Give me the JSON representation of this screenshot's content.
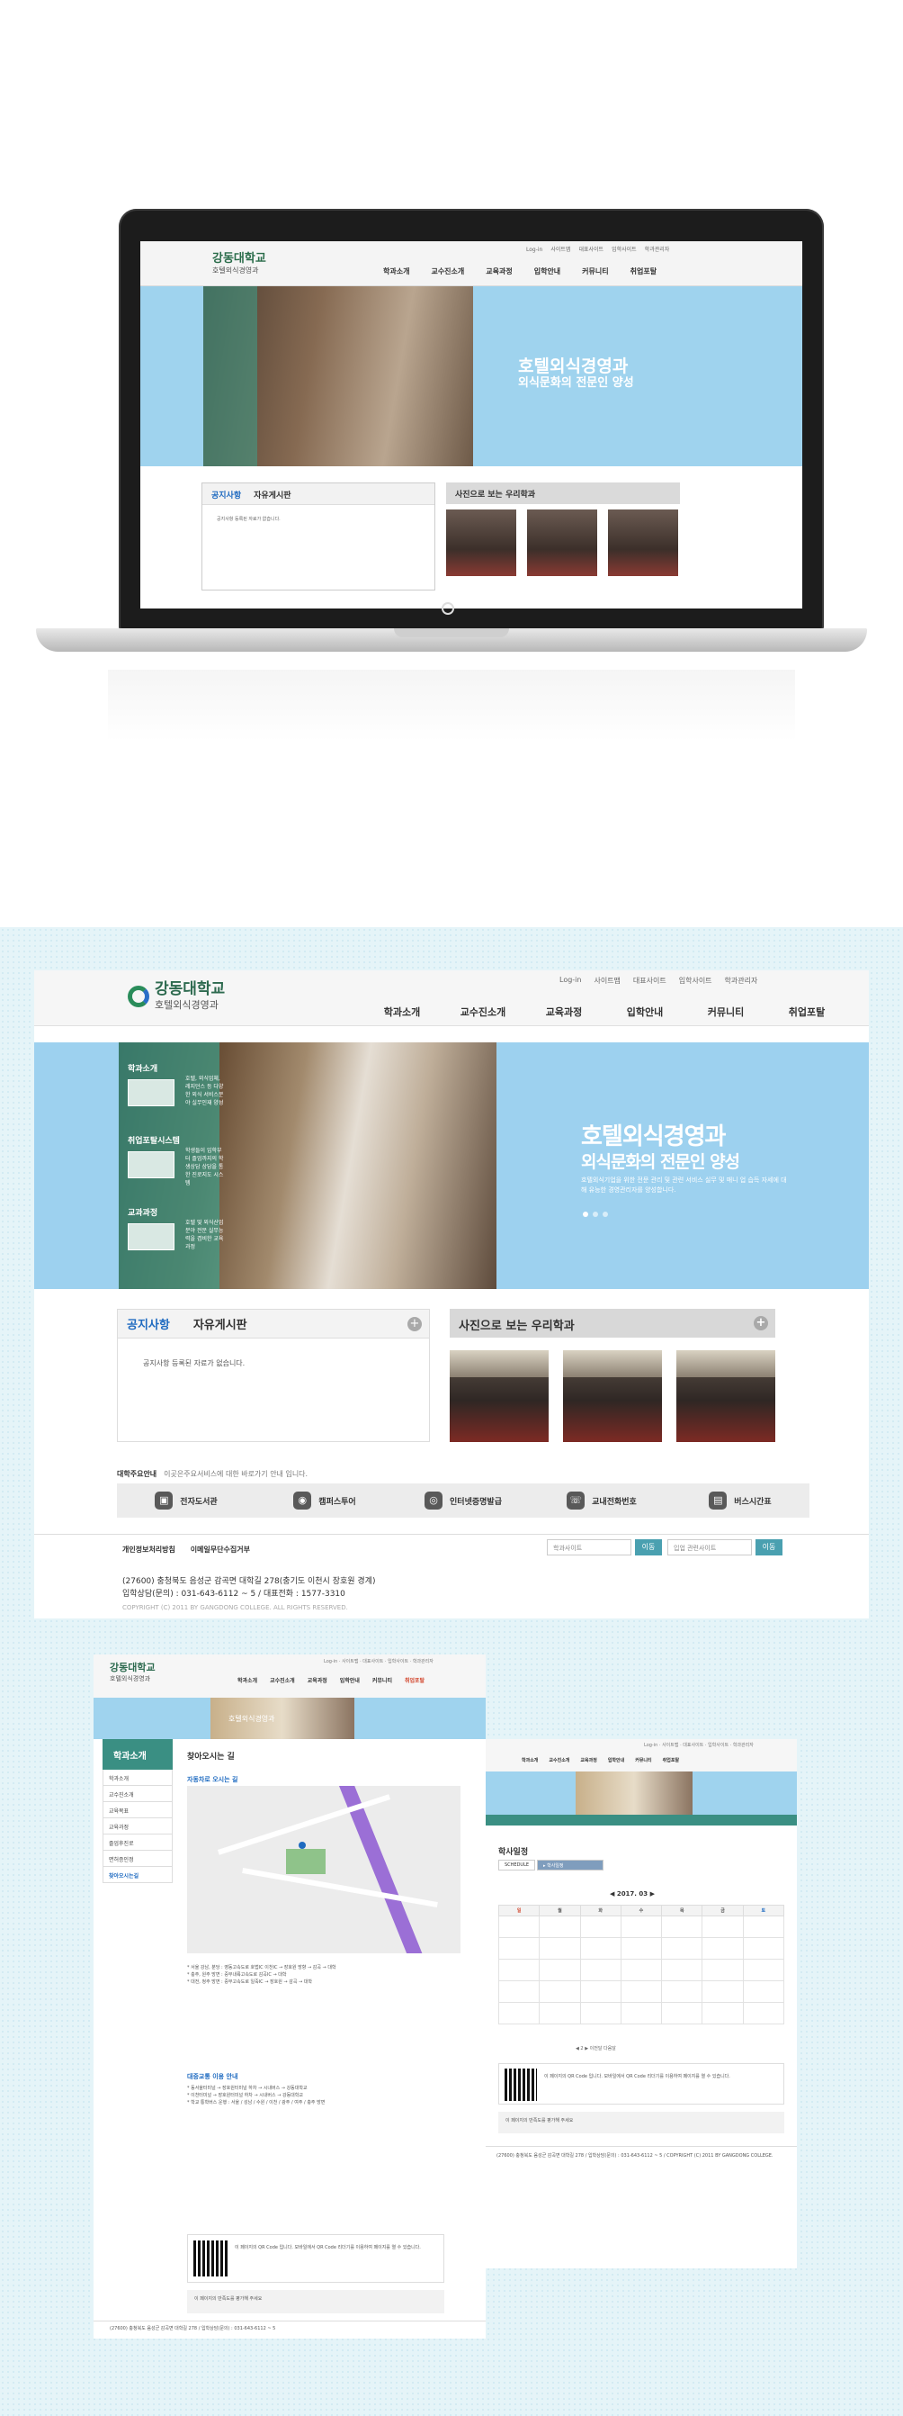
{
  "brand": {
    "name": "강동대학교",
    "dept": "호텔외식경영과"
  },
  "laptop": {
    "util": [
      "Log-in",
      "사이트맵",
      "대표사이트",
      "입학사이트",
      "학과관리자"
    ],
    "nav": [
      "학과소개",
      "교수진소개",
      "교육과정",
      "입학안내",
      "커뮤니티",
      "취업포탈"
    ],
    "hero_title": "호텔외식경영과",
    "hero_sub": "외식문화의 전문인 양성",
    "notice_tab": "공지사항",
    "board_tab": "자유게시판",
    "photo_title": "사진으로 보는 우리학과",
    "notice_empty": "공지사항 등록된 자료가 없습니다."
  },
  "main": {
    "util": [
      "Log-in",
      "사이트맵",
      "대표사이트",
      "입학사이트",
      "학과관리자"
    ],
    "nav": [
      "학과소개",
      "교수진소개",
      "교육과정",
      "입학안내",
      "커뮤니티",
      "취업포탈"
    ],
    "quick": [
      {
        "title": "학과소개",
        "desc": "호텔, 외식업체, 레지던스 등 다양한 외식 서비스분야 실무인재 양성"
      },
      {
        "title": "취업포탈시스템",
        "desc": "학생들이 입학부터 졸업까지의 학생상담 상담을 통한 진로지도 시스템"
      },
      {
        "title": "교과과정",
        "desc": "호텔 및 외식산업 분야 전문 실무능력을 겸비한 교육과정"
      }
    ],
    "hero_title": "호텔외식경영과",
    "hero_sub": "외식문화의 전문인 양성",
    "hero_desc": "호텔외식기업을 위한 전문 관리 및 관련 서비스 실무 및 매니 업 습득 자세에 대해 유능한 경영관리자를 양성합니다.",
    "notice_tab": "공지사항",
    "board_tab": "자유게시판",
    "notice_empty": "공지사항 등록된 자료가 없습니다.",
    "photo_title": "사진으로 보는 우리학과",
    "plus": "+",
    "site_label": "대학주요안내",
    "site_desc": "이곳은주요서비스에 대한 바로가기 안내 입니다.",
    "services": [
      {
        "icon": "▣",
        "icon_name": "book-icon",
        "label": "전자도서관"
      },
      {
        "icon": "◉",
        "icon_name": "camera-icon",
        "label": "캠퍼스투어"
      },
      {
        "icon": "◎",
        "icon_name": "certificate-icon",
        "label": "인터넷증명발급"
      },
      {
        "icon": "☏",
        "icon_name": "phone-icon",
        "label": "교내전화번호"
      },
      {
        "icon": "▤",
        "icon_name": "bus-icon",
        "label": "버스시간표"
      }
    ],
    "footer_links": [
      "개인정보처리방침",
      "이메일무단수집거부"
    ],
    "select1": "학과사이트",
    "select2": "입업 관련사이트",
    "go": "이동",
    "address": "(27600) 충청북도 음성군 감곡면 대학길 278(충기도 이천시 장호원 경계)",
    "phone": "입학상담(문의) : 031-643-6112 ~ 5 / 대표전화 : 1577-3310",
    "copyright": "COPYRIGHT (C) 2011 BY GANGDONG COLLEGE. ALL RIGHTS RESERVED."
  },
  "sub1": {
    "band_title": "호텔외식경영과",
    "lnb_title": "학과소개",
    "lnb": [
      "학과소개",
      "교수진소개",
      "교육목표",
      "교육과정",
      "졸업후진로",
      "면허증인정",
      "찾아오시는길",
      "찾아오시는 길"
    ],
    "page_title": "찾아오시는 길",
    "section1": "자동차로 오시는 길",
    "section2": "대중교통 이용 안내",
    "route_text": "* 서울 강남, 분당 : 영동고속도로 호법IC 이천IC → 장호원 방향 → 감곡 → 대학\n* 충주, 원주 방면 : 중부내륙고속도로 감곡IC → 대학\n* 대전, 청주 방면 : 중부고속도로 일죽IC → 장호원 → 감곡 → 대학",
    "transit_text": "* 동서울터미널 → 장호원터미널 하차 → 시내버스 → 강동대학교\n* 이천터미널 → 장호원터미널 하차 → 시내버스 → 강동대학교\n* 학교 통학버스 운행 : 서울 / 성남 / 수원 / 이천 / 광주 / 여주 / 충주 방면",
    "qr_text": "이 페이지의 QR Code 입니다. 모바일에서 QR Code 리더기를 이용하여 페이지를 열 수 있습니다.",
    "sat_title": "이 페이지의 만족도를 평가해 주세요",
    "footer": "(27600) 충청북도 음성군 감곡면 대학길 278 / 입학상담(문의) : 031-643-6112 ~ 5"
  },
  "sub2": {
    "util": [
      "Log-in",
      "사이트맵",
      "대표사이트",
      "입학사이트",
      "학과관리자"
    ],
    "nav": [
      "학과소개",
      "교수진소개",
      "교육과정",
      "입학안내",
      "커뮤니티",
      "취업포탈"
    ],
    "page_title": "학사일정",
    "tab1": "SCHEDULE",
    "tab2": "▸ 학사일정",
    "month": "◀ 2017. 03 ▶",
    "weekdays": [
      "일",
      "월",
      "화",
      "수",
      "목",
      "금",
      "토"
    ],
    "pager": "◀ 2 ▶   이전달   다음달",
    "qr_text": "이 페이지의 QR Code 입니다. 모바일에서 QR Code 리더기를 이용하여 페이지를 열 수 있습니다.",
    "sat_title": "이 페이지의 만족도를 평가해 주세요",
    "footer": "(27600) 충청북도 음성군 감곡면 대학길 278 / 입학상담(문의) : 031-643-6112 ~ 5 / COPYRIGHT (C) 2011 BY GANGDONG COLLEGE."
  }
}
